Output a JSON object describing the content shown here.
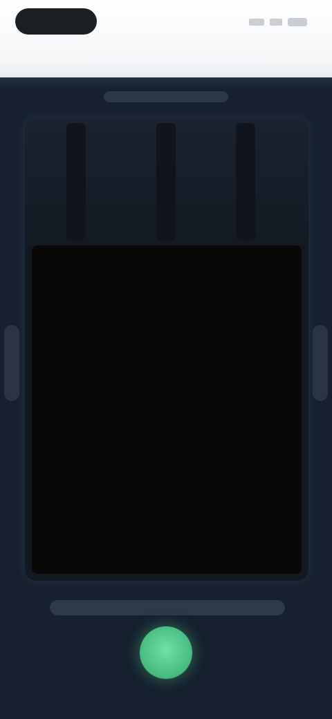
{
  "status": {
    "time": "",
    "title": ""
  },
  "screen": {
    "subtitle": "",
    "hint": ""
  },
  "colors": {
    "accent": "#47b97f",
    "background": "#16202e",
    "preview": "#0a0707"
  }
}
